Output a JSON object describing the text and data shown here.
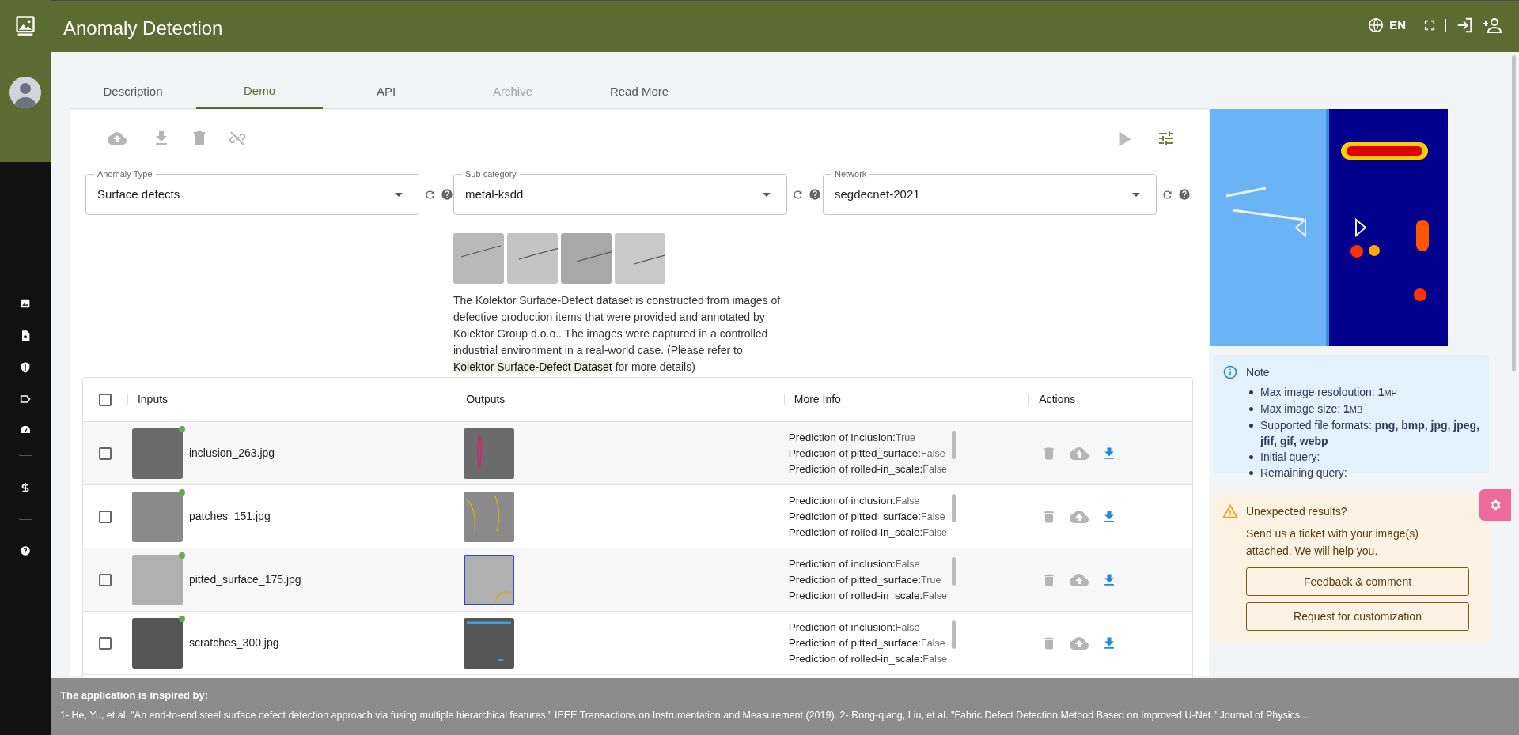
{
  "header": {
    "title": "Anomaly Detection",
    "language": "EN"
  },
  "tabs": [
    {
      "label": "Description",
      "selected": false,
      "disabled": false
    },
    {
      "label": "Demo",
      "selected": true,
      "disabled": false
    },
    {
      "label": "API",
      "selected": false,
      "disabled": false
    },
    {
      "label": "Archive",
      "selected": false,
      "disabled": true
    },
    {
      "label": "Read More",
      "selected": false,
      "disabled": false
    }
  ],
  "selects": [
    {
      "label": "Anomaly Type",
      "value": "Surface defects"
    },
    {
      "label": "Sub category",
      "value": "metal-ksdd"
    },
    {
      "label": "Network",
      "value": "segdecnet-2021"
    }
  ],
  "dataset": {
    "text_before": "The Kolektor Surface-Defect dataset is constructed from images of defective production items that were provided and annotated by Kolektor Group d.o.o.. The images were captured in a controlled industrial environment in a real-world case. (Please refer to",
    "link": "Kolektor Surface-Defect Dataset",
    "text_after": "for more details)"
  },
  "table": {
    "all_checked": false,
    "columns": [
      "Inputs",
      "Outputs",
      "More Info",
      "Actions"
    ],
    "rows": [
      {
        "file": "inclusion_263.jpg",
        "checked": false,
        "predictions": [
          {
            "label": "Prediction of inclusion:",
            "value": "True"
          },
          {
            "label": "Prediction of pitted_surface:",
            "value": "False"
          },
          {
            "label": "Prediction of rolled-in_scale:",
            "value": "False"
          }
        ]
      },
      {
        "file": "patches_151.jpg",
        "checked": false,
        "predictions": [
          {
            "label": "Prediction of inclusion:",
            "value": "False"
          },
          {
            "label": "Prediction of pitted_surface:",
            "value": "False"
          },
          {
            "label": "Prediction of rolled-in_scale:",
            "value": "False"
          }
        ]
      },
      {
        "file": "pitted_surface_175.jpg",
        "checked": false,
        "predictions": [
          {
            "label": "Prediction of inclusion:",
            "value": "False"
          },
          {
            "label": "Prediction of pitted_surface:",
            "value": "True"
          },
          {
            "label": "Prediction of rolled-in_scale:",
            "value": "False"
          }
        ]
      },
      {
        "file": "scratches_300.jpg",
        "checked": false,
        "predictions": [
          {
            "label": "Prediction of inclusion:",
            "value": "False"
          },
          {
            "label": "Prediction of pitted_surface:",
            "value": "False"
          },
          {
            "label": "Prediction of rolled-in_scale:",
            "value": "False"
          }
        ]
      }
    ]
  },
  "note": {
    "title": "Note",
    "items": [
      {
        "text": "Max image resoloution: ",
        "value": "1",
        "unit": "MP"
      },
      {
        "text": "Max image size: ",
        "value": "1",
        "unit": "MB"
      },
      {
        "text": "Supported file formats: ",
        "value": "png, bmp, jpg, jpeg, jfif, gif, webp"
      },
      {
        "text": "Initial query:"
      },
      {
        "text": "Remaining query:"
      }
    ]
  },
  "warning": {
    "title": "Unexpected results?",
    "text": "Send us a ticket with your image(s) attached. We will help you.",
    "buttons": [
      "Feedback & comment",
      "Request for customization"
    ]
  },
  "footer": {
    "title": "The application is inspired by:",
    "text": "1- He, Yu, et al. \"An end-to-end steel surface defect detection approach via fusing multiple hierarchical features.\" IEEE Transactions on Instrumentation and Measurement (2019). 2- Rong-qiang, Liu, et al. \"Fabric Defect Detection Method Based on Improved U-Net.\" Journal of Physics ..."
  }
}
